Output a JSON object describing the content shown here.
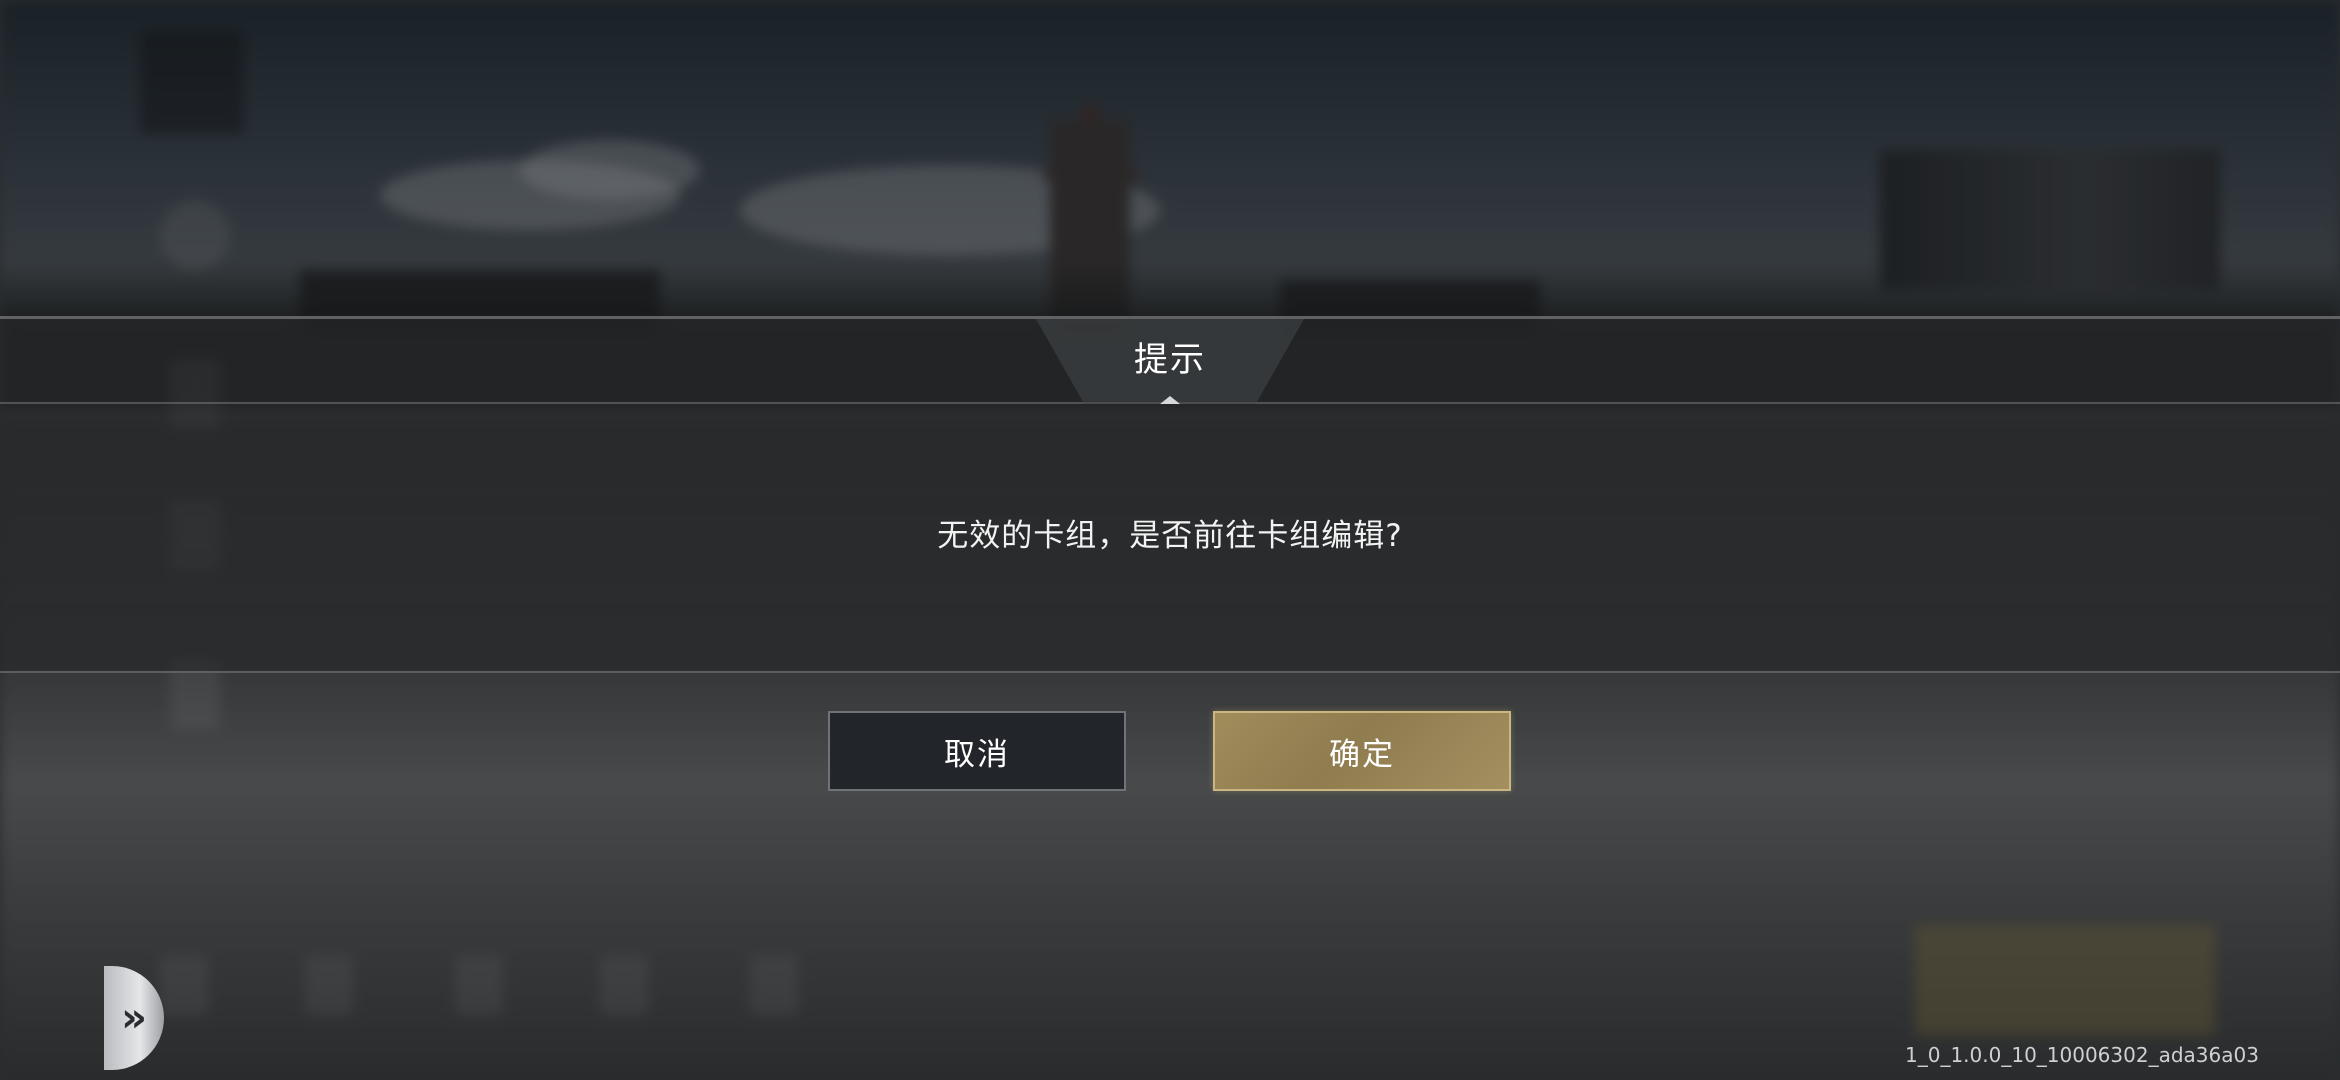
{
  "dialog": {
    "title": "提示",
    "message": "无效的卡组，是否前往卡组编辑?",
    "cancel_label": "取消",
    "confirm_label": "确定"
  },
  "footer": {
    "version": "1_0_1.0.0_10_10006302_ada36a03"
  },
  "icons": {
    "expand": "double-chevron-right-icon"
  },
  "colors": {
    "confirm_button": "#a08d5c",
    "cancel_button": "#22252a",
    "text": "#ffffff"
  }
}
